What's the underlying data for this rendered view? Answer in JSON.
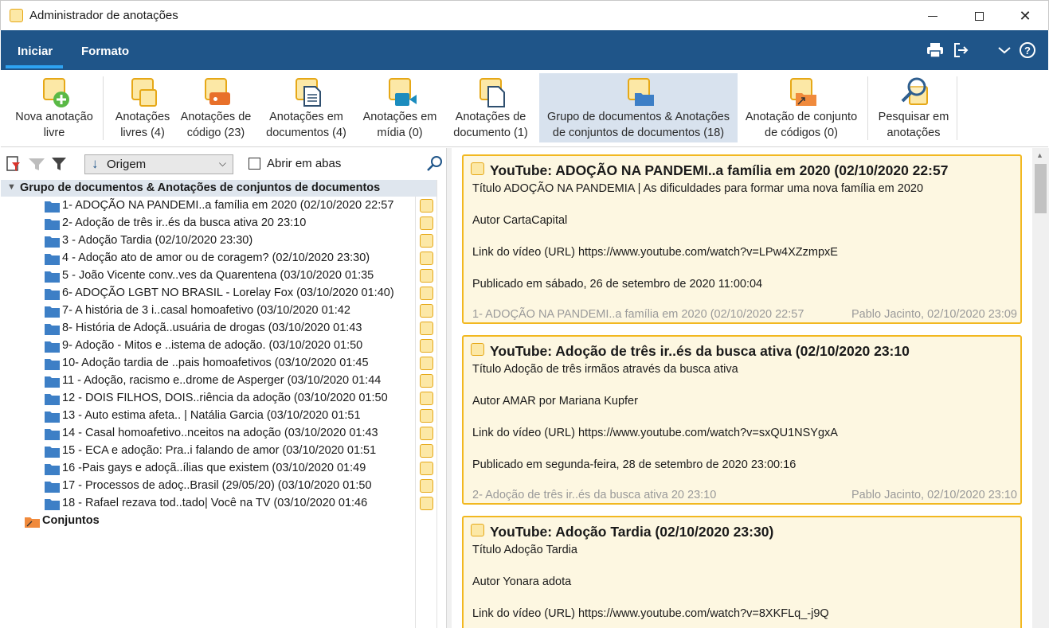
{
  "window": {
    "title": "Administrador de anotações",
    "controls": [
      "minimize-icon",
      "maximize-icon",
      "close-icon"
    ]
  },
  "tabs": [
    {
      "label": "Iniciar",
      "active": true
    },
    {
      "label": "Formato",
      "active": false
    }
  ],
  "tab_icons": [
    "print-icon",
    "export-icon",
    "chevron-down-icon",
    "help-icon"
  ],
  "ribbon": [
    {
      "label": "Nova anotação livre",
      "l1": "Nova anotação",
      "l2": "livre",
      "icon": "new-note-icon"
    },
    {
      "label": "Anotações livres (4)",
      "l1": "Anotações",
      "l2": "livres (4)",
      "icon": "free-notes-icon"
    },
    {
      "label": "Anotações de código (23)",
      "l1": "Anotações de",
      "l2": "código (23)",
      "icon": "code-notes-icon"
    },
    {
      "label": "Anotações em documentos (4)",
      "l1": "Anotações em",
      "l2": "documentos (4)",
      "icon": "document-notes-icon"
    },
    {
      "label": "Anotações em mídia (0)",
      "l1": "Anotações em",
      "l2": "mídia (0)",
      "icon": "media-notes-icon"
    },
    {
      "label": "Anotações de documento (1)",
      "l1": "Anotações de",
      "l2": "documento (1)",
      "icon": "doc-note-icon"
    },
    {
      "label": "Grupo de documentos & Anotações de conjuntos de documentos (18)",
      "l1": "Grupo de documentos & Anotações",
      "l2": "de conjuntos de documentos (18)",
      "icon": "doc-group-notes-icon",
      "selected": true
    },
    {
      "label": "Anotação de conjunto de códigos (0)",
      "l1": "Anotação de conjunto",
      "l2": "de códigos (0)",
      "icon": "code-set-note-icon"
    },
    {
      "label": "Pesquisar em anotações",
      "l1": "Pesquisar em",
      "l2": "anotações",
      "icon": "search-notes-icon"
    }
  ],
  "left_toolbar": {
    "origem_label": "Origem",
    "abrir_label": "Abrir em abas",
    "abrir_checked": false
  },
  "tree": {
    "header": "Grupo de documentos & Anotações de conjuntos de documentos",
    "items": [
      "1- ADOÇÃO NA PANDEMI..a família em 2020 (02/10/2020 22:57",
      "2- Adoção de três ir..és da busca ativa 20 23:10",
      "3 - Adoção Tardia (02/10/2020 23:30)",
      "4 - Adoção ato de amor ou de coragem? (02/10/2020 23:30)",
      "5 - João Vicente conv..ves da Quarentena (03/10/2020 01:35",
      "6- ADOÇÃO LGBT NO BRASIL - Lorelay Fox (03/10/2020 01:40)",
      "7- A história de 3 i..casal homoafetivo (03/10/2020 01:42",
      "8- História de Adoçã..usuária de drogas (03/10/2020 01:43",
      "9- Adoção - Mitos e ..istema de adoção. (03/10/2020 01:50",
      "10- Adoção tardia de ..pais homoafetivos (03/10/2020 01:45",
      "11 - Adoção, racismo e..drome de Asperger (03/10/2020 01:44",
      "12 - DOIS FILHOS, DOIS..riência da adoção (03/10/2020 01:50",
      "13 - Auto estima afeta.. | Natália Garcia (03/10/2020 01:51",
      "14 - Casal homoafetivo..nceitos na adoção (03/10/2020 01:43",
      "15 - ECA e adoção: Pra..i falando de amor (03/10/2020 01:51",
      "16 -Pais gays e adoçã..ílias que existem (03/10/2020 01:49",
      "17 - Processos de adoç..Brasil (29/05/20) (03/10/2020 01:50",
      "18 - Rafael rezava tod..tado| Você na TV (03/10/2020 01:46"
    ],
    "conjuntos": "Conjuntos"
  },
  "cards": [
    {
      "title": "YouTube: ADOÇÃO NA PANDEMI..a família em 2020 (02/10/2020 22:57",
      "lines": [
        "Título ADOÇÃO NA PANDEMIA | As dificuldades para formar uma nova família em 2020",
        "Autor CartaCapital",
        "Link do vídeo (URL) https://www.youtube.com/watch?v=LPw4XZzmpxE",
        "Publicado em sábado, 26 de setembro de 2020 11:00:04"
      ],
      "source": "1- ADOÇÃO NA PANDEMI..a família em 2020 (02/10/2020 22:57",
      "author": "Pablo Jacinto, 02/10/2020 23:09"
    },
    {
      "title": "YouTube: Adoção de três ir..és da busca ativa (02/10/2020 23:10",
      "lines": [
        "Título Adoção de três irmãos através da busca ativa",
        "Autor AMAR por Mariana Kupfer",
        "Link do vídeo (URL) https://www.youtube.com/watch?v=sxQU1NSYgxA",
        "Publicado em segunda-feira, 28 de setembro de 2020 23:00:16"
      ],
      "source": "2- Adoção de três ir..és da busca ativa 20 23:10",
      "author": "Pablo Jacinto, 02/10/2020 23:10"
    },
    {
      "title": "YouTube: Adoção Tardia (02/10/2020 23:30)",
      "lines": [
        "Título Adoção Tardia",
        "Autor Yonara adota",
        "Link do vídeo (URL) https://www.youtube.com/watch?v=8XKFLq_-j9Q"
      ],
      "source": "",
      "author": ""
    }
  ],
  "colors": {
    "ribbon_bar": "#1f5589",
    "tab_underline": "#2ea3f2",
    "note_fill": "#fce8a6",
    "note_border": "#e6a817",
    "card_bg": "#fdf7e1",
    "card_border": "#f2b820",
    "folder_blue": "#3d7fc6",
    "selected_ribbon": "#d8e2ee"
  }
}
